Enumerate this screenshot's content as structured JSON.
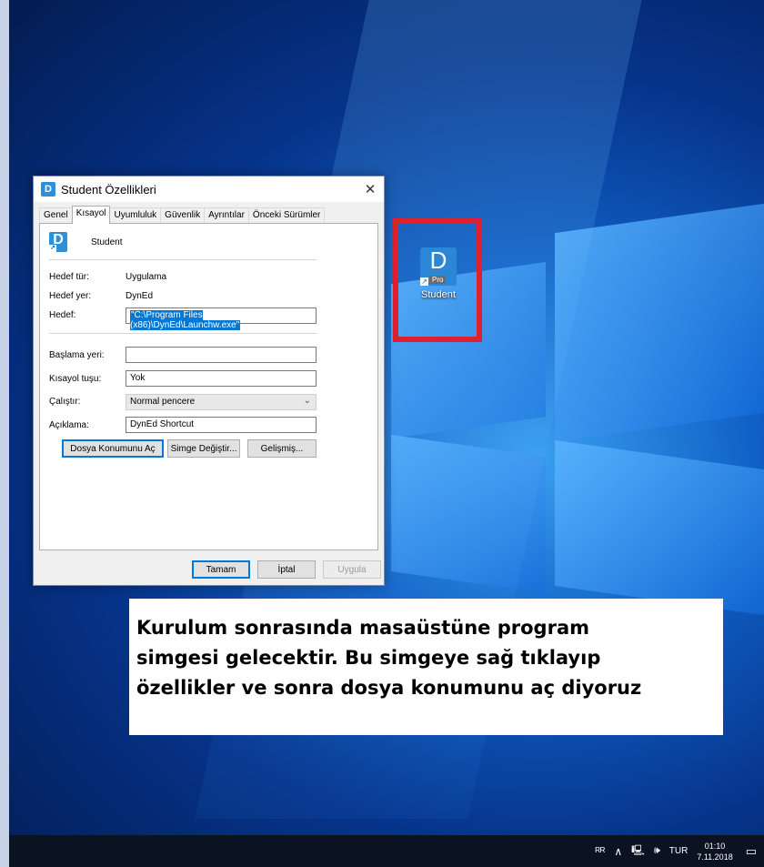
{
  "dialog": {
    "title": "Student Özellikleri",
    "close_glyph": "✕",
    "tabs": [
      "Genel",
      "Kısayol",
      "Uyumluluk",
      "Güvenlik",
      "Ayrıntılar",
      "Önceki Sürümler"
    ],
    "active_tab": "Kısayol",
    "shortcut_name": "Student",
    "target_type_label": "Hedef tür:",
    "target_type_value": "Uygulama",
    "target_location_label": "Hedef yer:",
    "target_location_value": "DynEd",
    "target_label": "Hedef:",
    "target_value": "\"C:\\Program Files (x86)\\DynEd\\Launchw.exe\"",
    "start_in_label": "Başlama yeri:",
    "start_in_value": "",
    "shortcut_key_label": "Kısayol tuşu:",
    "shortcut_key_value": "Yok",
    "run_label": "Çalıştır:",
    "run_value": "Normal pencere",
    "comment_label": "Açıklama:",
    "comment_value": "DynEd Shortcut",
    "open_location_button": "Dosya Konumunu Aç",
    "change_icon_button": "Simge Değiştir...",
    "advanced_button": "Gelişmiş...",
    "ok_button": "Tamam",
    "cancel_button": "İptal",
    "apply_button": "Uygula"
  },
  "desktop_icon": {
    "letter": "D",
    "badge": "Pro",
    "label": "Student",
    "highlight_color": "#e0202e"
  },
  "caption": {
    "line1": "Kurulum sonrasında masaüstüne program",
    "line2": "simgesi gelecektir. Bu simgeye sağ tıklayıp",
    "line3": "özellikler ve sonra dosya konumunu aç diyoruz"
  },
  "taskbar": {
    "language": "TUR",
    "time": "01:10",
    "date": "7.11.2018"
  }
}
